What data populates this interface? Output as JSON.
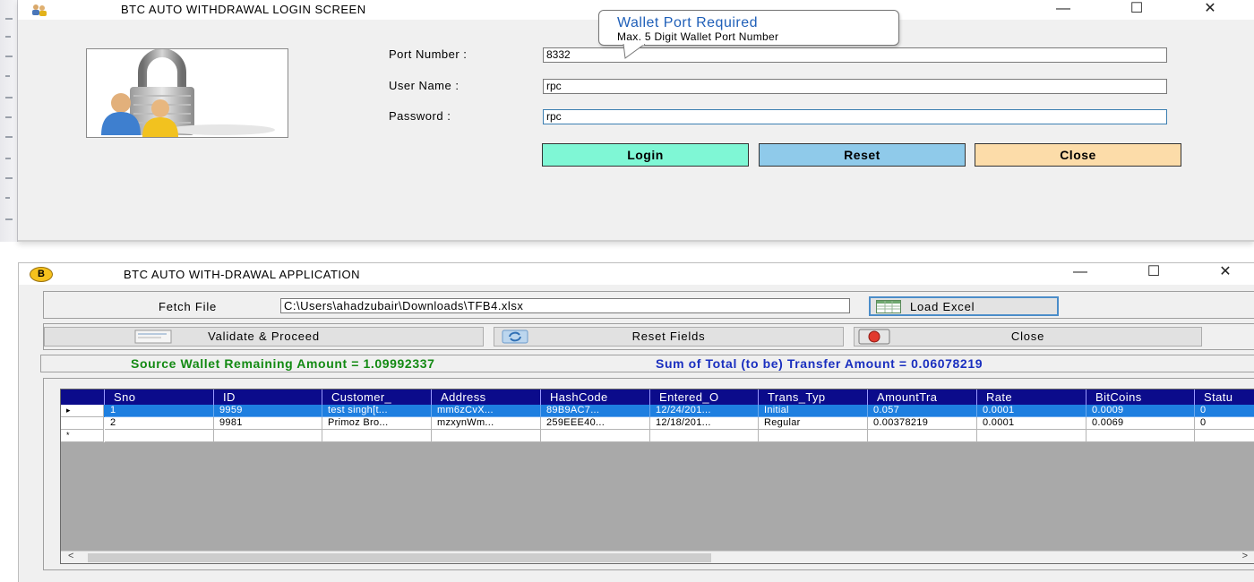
{
  "login_window": {
    "title": "BTC AUTO WITHDRAWAL LOGIN SCREEN",
    "minimize": "—",
    "maximize": "☐",
    "close": "✕",
    "tooltip": {
      "title": "Wallet Port Required",
      "text": "Max. 5 Digit Wallet Port Number"
    },
    "fields": {
      "port_label": "Port Number :",
      "port_value": "8332",
      "user_label": "User Name :",
      "user_value": "rpc",
      "password_label": "Password :",
      "password_value": "rpc"
    },
    "buttons": {
      "login": "Login",
      "reset": "Reset",
      "close": "Close"
    }
  },
  "app_window": {
    "icon_letter": "B",
    "title": "BTC AUTO WITH-DRAWAL APPLICATION",
    "minimize": "—",
    "maximize": "☐",
    "close": "✕",
    "fetch_label": "Fetch File",
    "file_path": "C:\\Users\\ahadzubair\\Downloads\\TFB4.xlsx",
    "load_excel": "Load Excel",
    "validate": "Validate & Proceed",
    "reset_fields": "Reset Fields",
    "close_btn": "Close",
    "status": {
      "source": "Source Wallet Remaining Amount = 1.09992337",
      "sum": "Sum of Total (to be) Transfer Amount = 0.06078219"
    },
    "grid": {
      "columns": [
        "Sno",
        "ID",
        "Customer_",
        "Address",
        "HashCode",
        "Entered_O",
        "Trans_Typ",
        "AmountTra",
        "Rate",
        "BitCoins",
        "Statu"
      ],
      "rows": [
        {
          "marker": "▸",
          "cells": [
            "1",
            "9959",
            "test singh[t...",
            "mm6zCvX...",
            "89B9AC7...",
            "12/24/201...",
            "Initial",
            "0.057",
            "0.0001",
            "0.0009",
            "0"
          ]
        },
        {
          "marker": "",
          "cells": [
            "2",
            "9981",
            "Primoz Bro...",
            "mzxynWm...",
            "259EEE40...",
            "12/18/201...",
            "Regular",
            "0.00378219",
            "0.0001",
            "0.0069",
            "0"
          ]
        },
        {
          "marker": "*",
          "cells": [
            "",
            "",
            "",
            "",
            "",
            "",
            "",
            "",
            "",
            "",
            ""
          ]
        }
      ],
      "scroll_left": "<",
      "scroll_right": ">"
    }
  },
  "colors": {
    "login_btn": "#7ff7d5",
    "reset_btn": "#8fcaea",
    "close_btn": "#fcdca9",
    "grid_header": "#0b0b8b",
    "selected_row": "#1e7fe0",
    "status_green": "#138a13",
    "status_blue": "#1a2fbf",
    "tooltip_title": "#1f5fb8"
  }
}
